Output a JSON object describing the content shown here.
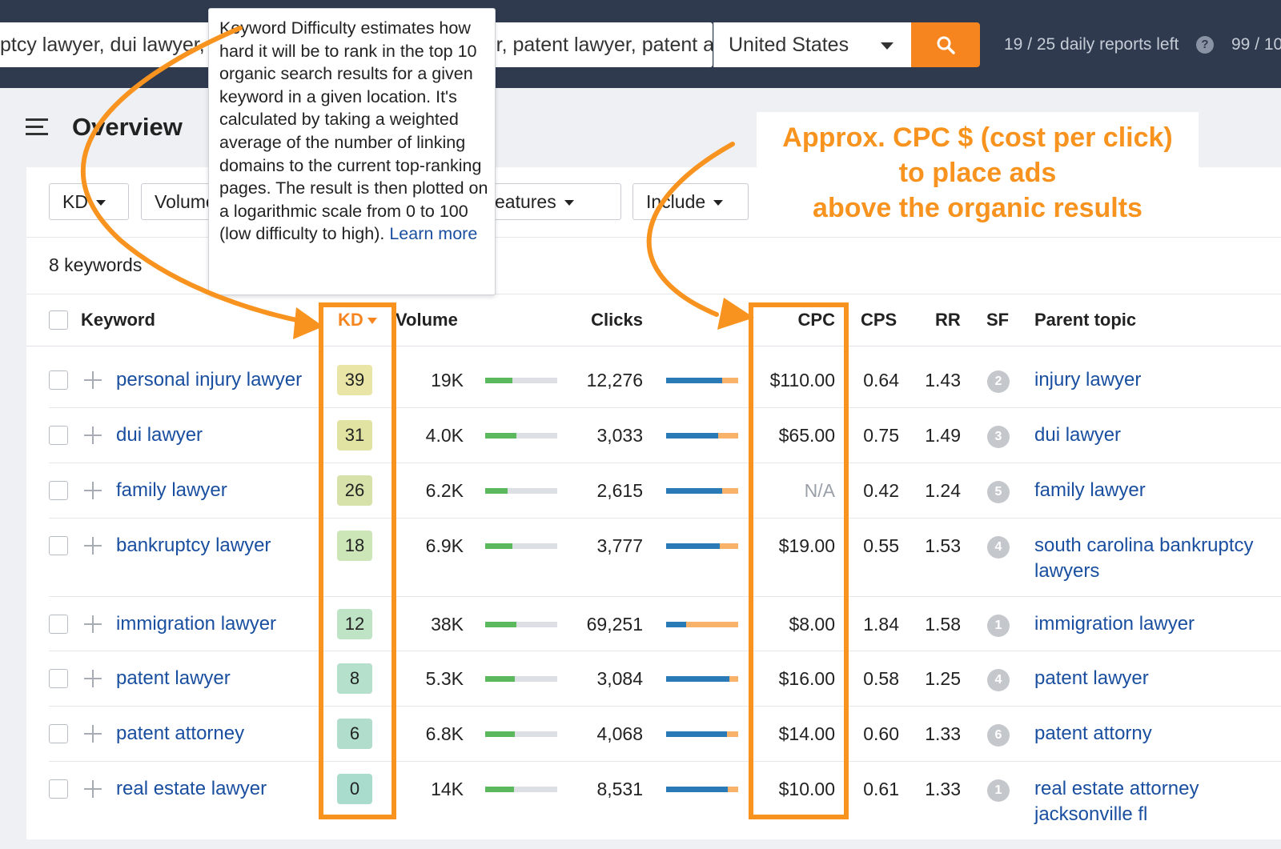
{
  "search": {
    "query": "ptcy lawyer, dui lawyer, family lawyer, immigration lawyer, patent lawyer, patent attorney, pate",
    "country": "United States",
    "reports_left": "19 / 25 daily reports left",
    "credits": "99 / 10"
  },
  "page": {
    "title": "Overview",
    "keyword_count": "8 keywords"
  },
  "filters": [
    {
      "label": "KD"
    },
    {
      "label": "Volume"
    },
    {
      "label": "SERP features"
    },
    {
      "label": "Include"
    }
  ],
  "table": {
    "headers": {
      "keyword": "Keyword",
      "kd": "KD",
      "volume": "Volume",
      "clicks": "Clicks",
      "cpc": "CPC",
      "cps": "CPS",
      "rr": "RR",
      "sf": "SF",
      "parent": "Parent topic"
    },
    "rows": [
      {
        "keyword": "personal injury lawyer",
        "kd": "39",
        "volume": "19K",
        "clicks": "12,276",
        "cpc": "$110.00",
        "cps": "0.64",
        "rr": "1.43",
        "sf": "2",
        "parent": "injury lawyer",
        "vol_fill": 0.38,
        "clk_fill": 0.78
      },
      {
        "keyword": "dui lawyer",
        "kd": "31",
        "volume": "4.0K",
        "clicks": "3,033",
        "cpc": "$65.00",
        "cps": "0.75",
        "rr": "1.49",
        "sf": "3",
        "parent": "dui lawyer",
        "vol_fill": 0.43,
        "clk_fill": 0.72
      },
      {
        "keyword": "family lawyer",
        "kd": "26",
        "volume": "6.2K",
        "clicks": "2,615",
        "cpc": "N/A",
        "cps": "0.42",
        "rr": "1.24",
        "sf": "5",
        "parent": "family lawyer",
        "vol_fill": 0.31,
        "clk_fill": 0.78
      },
      {
        "keyword": "bankruptcy lawyer",
        "kd": "18",
        "volume": "6.9K",
        "clicks": "3,777",
        "cpc": "$19.00",
        "cps": "0.55",
        "rr": "1.53",
        "sf": "4",
        "parent": "south carolina bankruptcy lawyers",
        "vol_fill": 0.38,
        "clk_fill": 0.74
      },
      {
        "keyword": "immigration lawyer",
        "kd": "12",
        "volume": "38K",
        "clicks": "69,251",
        "cpc": "$8.00",
        "cps": "1.84",
        "rr": "1.58",
        "sf": "1",
        "parent": "immigration lawyer",
        "vol_fill": 0.43,
        "clk_fill": 0.28
      },
      {
        "keyword": "patent lawyer",
        "kd": "8",
        "volume": "5.3K",
        "clicks": "3,084",
        "cpc": "$16.00",
        "cps": "0.58",
        "rr": "1.25",
        "sf": "4",
        "parent": "patent lawyer",
        "vol_fill": 0.41,
        "clk_fill": 0.88
      },
      {
        "keyword": "patent attorney",
        "kd": "6",
        "volume": "6.8K",
        "clicks": "4,068",
        "cpc": "$14.00",
        "cps": "0.60",
        "rr": "1.33",
        "sf": "6",
        "parent": "patent attorny",
        "vol_fill": 0.41,
        "clk_fill": 0.84
      },
      {
        "keyword": "real estate lawyer",
        "kd": "0",
        "volume": "14K",
        "clicks": "8,531",
        "cpc": "$10.00",
        "cps": "0.61",
        "rr": "1.33",
        "sf": "1",
        "parent": "real estate attorney jacksonville fl",
        "vol_fill": 0.4,
        "clk_fill": 0.85
      }
    ]
  },
  "tooltip": {
    "text": "Keyword Difficulty estimates how hard it will be to rank in the top 10 organic search results for a given keyword in a given location. It's calculated by taking a weighted average of the number of linking domains to the current top-ranking pages. The result is then plotted on a logarithmic scale from 0 to 100 (low difficulty to high).",
    "link": "Learn more"
  },
  "annotation": {
    "line1": "Approx. CPC $ (cost per click)",
    "line2": "to place ads",
    "line3": "above the organic results"
  },
  "colors": {
    "accent": "#f7931e",
    "link": "#1a4fa0",
    "topbar": "#2f3a4f",
    "volume_bar": "#5cb85c",
    "clicks_bar": "#2a7ab8",
    "clicks_bar_rest": "#f8b26a",
    "kd_colors": [
      "#e8e5a6",
      "#e1e3a2",
      "#d7e2ab",
      "#cde6b8",
      "#bfe4c5",
      "#b5e0cb",
      "#b0ddcc",
      "#a9dccd"
    ]
  }
}
